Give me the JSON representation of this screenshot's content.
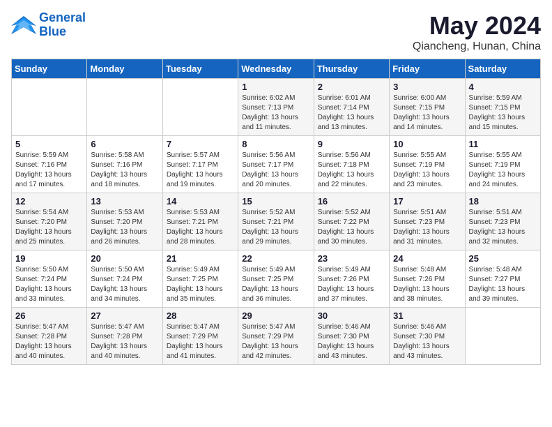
{
  "logo": {
    "line1": "General",
    "line2": "Blue"
  },
  "header": {
    "month": "May 2024",
    "location": "Qiancheng, Hunan, China"
  },
  "days_of_week": [
    "Sunday",
    "Monday",
    "Tuesday",
    "Wednesday",
    "Thursday",
    "Friday",
    "Saturday"
  ],
  "weeks": [
    [
      {
        "day": "",
        "info": ""
      },
      {
        "day": "",
        "info": ""
      },
      {
        "day": "",
        "info": ""
      },
      {
        "day": "1",
        "info": "Sunrise: 6:02 AM\nSunset: 7:13 PM\nDaylight: 13 hours\nand 11 minutes."
      },
      {
        "day": "2",
        "info": "Sunrise: 6:01 AM\nSunset: 7:14 PM\nDaylight: 13 hours\nand 13 minutes."
      },
      {
        "day": "3",
        "info": "Sunrise: 6:00 AM\nSunset: 7:15 PM\nDaylight: 13 hours\nand 14 minutes."
      },
      {
        "day": "4",
        "info": "Sunrise: 5:59 AM\nSunset: 7:15 PM\nDaylight: 13 hours\nand 15 minutes."
      }
    ],
    [
      {
        "day": "5",
        "info": "Sunrise: 5:59 AM\nSunset: 7:16 PM\nDaylight: 13 hours\nand 17 minutes."
      },
      {
        "day": "6",
        "info": "Sunrise: 5:58 AM\nSunset: 7:16 PM\nDaylight: 13 hours\nand 18 minutes."
      },
      {
        "day": "7",
        "info": "Sunrise: 5:57 AM\nSunset: 7:17 PM\nDaylight: 13 hours\nand 19 minutes."
      },
      {
        "day": "8",
        "info": "Sunrise: 5:56 AM\nSunset: 7:17 PM\nDaylight: 13 hours\nand 20 minutes."
      },
      {
        "day": "9",
        "info": "Sunrise: 5:56 AM\nSunset: 7:18 PM\nDaylight: 13 hours\nand 22 minutes."
      },
      {
        "day": "10",
        "info": "Sunrise: 5:55 AM\nSunset: 7:19 PM\nDaylight: 13 hours\nand 23 minutes."
      },
      {
        "day": "11",
        "info": "Sunrise: 5:55 AM\nSunset: 7:19 PM\nDaylight: 13 hours\nand 24 minutes."
      }
    ],
    [
      {
        "day": "12",
        "info": "Sunrise: 5:54 AM\nSunset: 7:20 PM\nDaylight: 13 hours\nand 25 minutes."
      },
      {
        "day": "13",
        "info": "Sunrise: 5:53 AM\nSunset: 7:20 PM\nDaylight: 13 hours\nand 26 minutes."
      },
      {
        "day": "14",
        "info": "Sunrise: 5:53 AM\nSunset: 7:21 PM\nDaylight: 13 hours\nand 28 minutes."
      },
      {
        "day": "15",
        "info": "Sunrise: 5:52 AM\nSunset: 7:21 PM\nDaylight: 13 hours\nand 29 minutes."
      },
      {
        "day": "16",
        "info": "Sunrise: 5:52 AM\nSunset: 7:22 PM\nDaylight: 13 hours\nand 30 minutes."
      },
      {
        "day": "17",
        "info": "Sunrise: 5:51 AM\nSunset: 7:23 PM\nDaylight: 13 hours\nand 31 minutes."
      },
      {
        "day": "18",
        "info": "Sunrise: 5:51 AM\nSunset: 7:23 PM\nDaylight: 13 hours\nand 32 minutes."
      }
    ],
    [
      {
        "day": "19",
        "info": "Sunrise: 5:50 AM\nSunset: 7:24 PM\nDaylight: 13 hours\nand 33 minutes."
      },
      {
        "day": "20",
        "info": "Sunrise: 5:50 AM\nSunset: 7:24 PM\nDaylight: 13 hours\nand 34 minutes."
      },
      {
        "day": "21",
        "info": "Sunrise: 5:49 AM\nSunset: 7:25 PM\nDaylight: 13 hours\nand 35 minutes."
      },
      {
        "day": "22",
        "info": "Sunrise: 5:49 AM\nSunset: 7:25 PM\nDaylight: 13 hours\nand 36 minutes."
      },
      {
        "day": "23",
        "info": "Sunrise: 5:49 AM\nSunset: 7:26 PM\nDaylight: 13 hours\nand 37 minutes."
      },
      {
        "day": "24",
        "info": "Sunrise: 5:48 AM\nSunset: 7:26 PM\nDaylight: 13 hours\nand 38 minutes."
      },
      {
        "day": "25",
        "info": "Sunrise: 5:48 AM\nSunset: 7:27 PM\nDaylight: 13 hours\nand 39 minutes."
      }
    ],
    [
      {
        "day": "26",
        "info": "Sunrise: 5:47 AM\nSunset: 7:28 PM\nDaylight: 13 hours\nand 40 minutes."
      },
      {
        "day": "27",
        "info": "Sunrise: 5:47 AM\nSunset: 7:28 PM\nDaylight: 13 hours\nand 40 minutes."
      },
      {
        "day": "28",
        "info": "Sunrise: 5:47 AM\nSunset: 7:29 PM\nDaylight: 13 hours\nand 41 minutes."
      },
      {
        "day": "29",
        "info": "Sunrise: 5:47 AM\nSunset: 7:29 PM\nDaylight: 13 hours\nand 42 minutes."
      },
      {
        "day": "30",
        "info": "Sunrise: 5:46 AM\nSunset: 7:30 PM\nDaylight: 13 hours\nand 43 minutes."
      },
      {
        "day": "31",
        "info": "Sunrise: 5:46 AM\nSunset: 7:30 PM\nDaylight: 13 hours\nand 43 minutes."
      },
      {
        "day": "",
        "info": ""
      }
    ]
  ]
}
